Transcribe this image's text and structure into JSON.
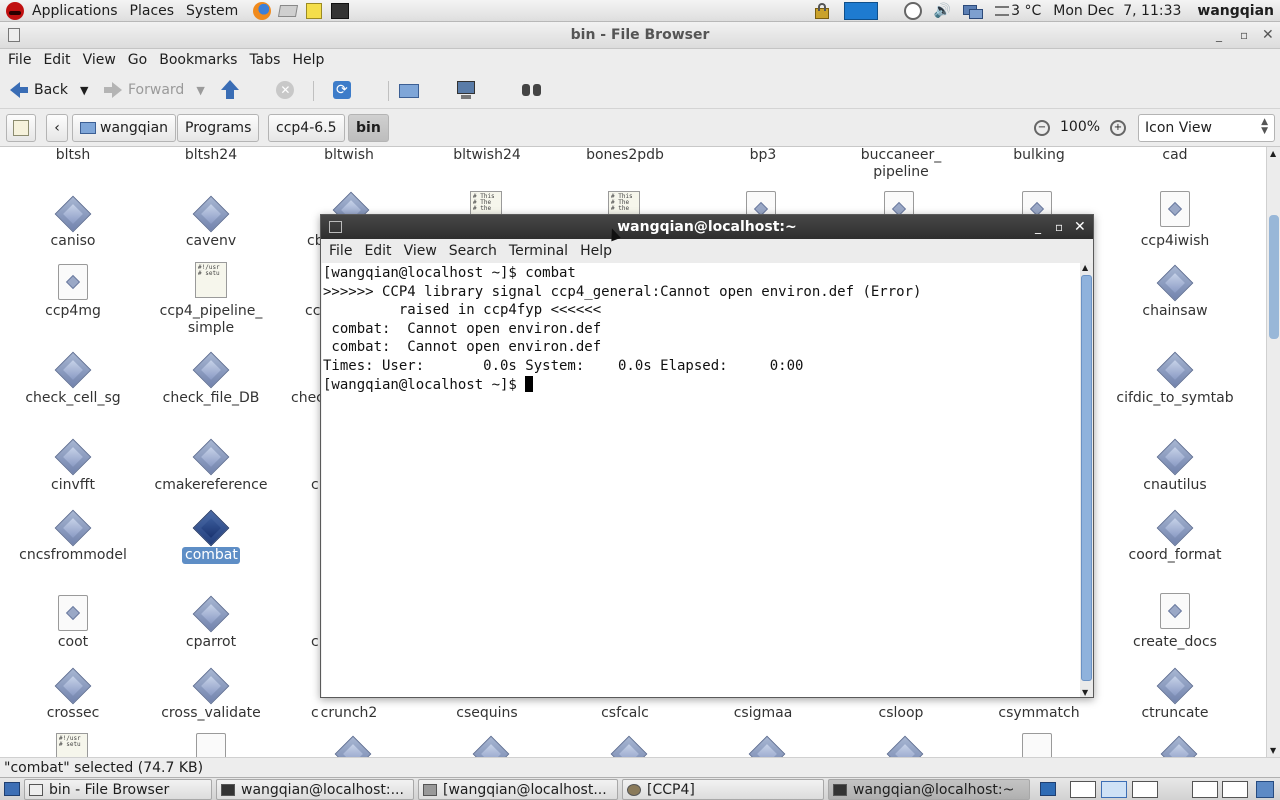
{
  "top_panel": {
    "menus": [
      "Applications",
      "Places",
      "System"
    ],
    "temperature": "3 °C",
    "datetime": "Mon Dec  7, 11:33",
    "user": "wangqian"
  },
  "file_browser": {
    "title": "bin - File Browser",
    "menus": [
      "File",
      "Edit",
      "View",
      "Go",
      "Bookmarks",
      "Tabs",
      "Help"
    ],
    "toolbar": {
      "back": "Back",
      "forward": "Forward"
    },
    "path": [
      "wangqian",
      "Programs",
      "ccp4-6.5",
      "bin"
    ],
    "zoom": "100%",
    "view_mode": "Icon View",
    "status": "\"combat\" selected (74.7 KB)",
    "items": [
      {
        "label": "bltsh",
        "icon": "none"
      },
      {
        "label": "bltsh24",
        "icon": "none"
      },
      {
        "label": "bltwish",
        "icon": "none"
      },
      {
        "label": "bltwish24",
        "icon": "none"
      },
      {
        "label": "bones2pdb",
        "icon": "none"
      },
      {
        "label": "bp3",
        "icon": "none"
      },
      {
        "label": "buccaneer_\npipeline",
        "icon": "none"
      },
      {
        "label": "bulking",
        "icon": "none"
      },
      {
        "label": "cad",
        "icon": "none"
      },
      {
        "label": "caniso",
        "icon": "exec"
      },
      {
        "label": "cavenv",
        "icon": "exec"
      },
      {
        "label": "ccp4iwish",
        "icon": "doc"
      },
      {
        "label": "ccp4mg",
        "icon": "doc"
      },
      {
        "label": "ccp4_pipeline_\nsimple",
        "icon": "script"
      },
      {
        "label": "chainsaw",
        "icon": "exec"
      },
      {
        "label": "check_cell_sg",
        "icon": "exec"
      },
      {
        "label": "check_file_DB",
        "icon": "exec"
      },
      {
        "label": "cifdic_to_symtab",
        "icon": "exec"
      },
      {
        "label": "cinvfft",
        "icon": "exec"
      },
      {
        "label": "cmakereference",
        "icon": "exec"
      },
      {
        "label": "cnautilus",
        "icon": "exec"
      },
      {
        "label": "cncsfrommodel",
        "icon": "exec"
      },
      {
        "label": "combat",
        "icon": "exec"
      },
      {
        "label": "coord_format",
        "icon": "exec"
      },
      {
        "label": "coot",
        "icon": "doc"
      },
      {
        "label": "cparrot",
        "icon": "exec"
      },
      {
        "label": "create_docs",
        "icon": "doc"
      },
      {
        "label": "crossec",
        "icon": "exec"
      },
      {
        "label": "cross_validate",
        "icon": "exec"
      },
      {
        "label": "crunch2",
        "icon": "none"
      },
      {
        "label": "csequins",
        "icon": "none"
      },
      {
        "label": "csfcalc",
        "icon": "none"
      },
      {
        "label": "csigmaa",
        "icon": "none"
      },
      {
        "label": "csloop",
        "icon": "none"
      },
      {
        "label": "csymmatch",
        "icon": "none"
      },
      {
        "label": "ctruncate",
        "icon": "exec"
      }
    ],
    "partial_labels": [
      "cb",
      "cc",
      "chec",
      "c",
      "c",
      "c"
    ],
    "script_lines": [
      "# This",
      "# The",
      "# the"
    ],
    "script_lines_alt": [
      "#!/usr",
      "# setu"
    ]
  },
  "terminal": {
    "title": "wangqian@localhost:~",
    "menus": [
      "File",
      "Edit",
      "View",
      "Search",
      "Terminal",
      "Help"
    ],
    "lines": [
      "[wangqian@localhost ~]$ combat",
      ">>>>>> CCP4 library signal ccp4_general:Cannot open environ.def (Error)",
      "         raised in ccp4fyp <<<<<<",
      " combat:  Cannot open environ.def",
      " combat:  Cannot open environ.def",
      "Times: User:       0.0s System:    0.0s Elapsed:     0:00",
      "[wangqian@localhost ~]$ "
    ]
  },
  "taskbar": {
    "tasks": [
      "bin - File Browser",
      "wangqian@localhost:...",
      "[wangqian@localhost...",
      "[CCP4]",
      "wangqian@localhost:~"
    ]
  }
}
